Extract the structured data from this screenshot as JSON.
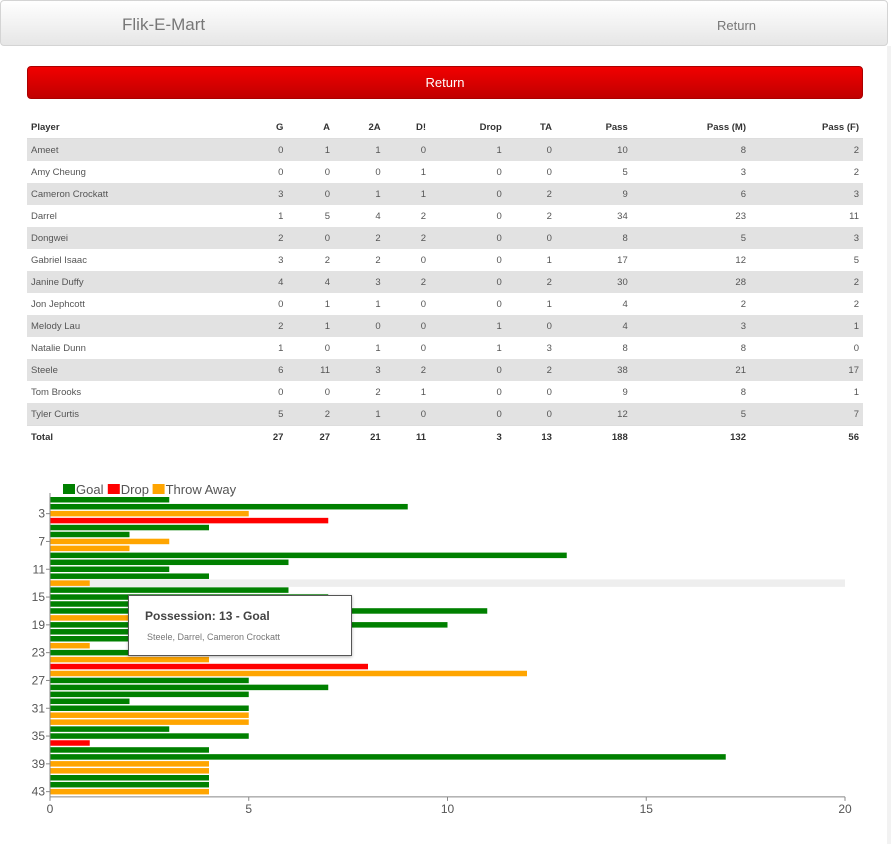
{
  "navbar": {
    "brand": "Flik-E-Mart",
    "return_label": "Return"
  },
  "return_button": {
    "label": "Return"
  },
  "stats_table": {
    "columns": [
      "Player",
      "G",
      "A",
      "2A",
      "D!",
      "Drop",
      "TA",
      "Pass",
      "Pass (M)",
      "Pass (F)"
    ],
    "rows": [
      [
        "Ameet",
        "0",
        "1",
        "1",
        "0",
        "1",
        "0",
        "10",
        "8",
        "2"
      ],
      [
        "Amy Cheung",
        "0",
        "0",
        "0",
        "1",
        "0",
        "0",
        "5",
        "3",
        "2"
      ],
      [
        "Cameron Crockatt",
        "3",
        "0",
        "1",
        "1",
        "0",
        "2",
        "9",
        "6",
        "3"
      ],
      [
        "Darrel",
        "1",
        "5",
        "4",
        "2",
        "0",
        "2",
        "34",
        "23",
        "11"
      ],
      [
        "Dongwei",
        "2",
        "0",
        "2",
        "2",
        "0",
        "0",
        "8",
        "5",
        "3"
      ],
      [
        "Gabriel Isaac",
        "3",
        "2",
        "2",
        "0",
        "0",
        "1",
        "17",
        "12",
        "5"
      ],
      [
        "Janine Duffy",
        "4",
        "4",
        "3",
        "2",
        "0",
        "2",
        "30",
        "28",
        "2"
      ],
      [
        "Jon Jephcott",
        "0",
        "1",
        "1",
        "0",
        "0",
        "1",
        "4",
        "2",
        "2"
      ],
      [
        "Melody Lau",
        "2",
        "1",
        "0",
        "0",
        "1",
        "0",
        "4",
        "3",
        "1"
      ],
      [
        "Natalie Dunn",
        "1",
        "0",
        "1",
        "0",
        "1",
        "3",
        "8",
        "8",
        "0"
      ],
      [
        "Steele",
        "6",
        "11",
        "3",
        "2",
        "0",
        "2",
        "38",
        "21",
        "17"
      ],
      [
        "Tom Brooks",
        "0",
        "0",
        "2",
        "1",
        "0",
        "0",
        "9",
        "8",
        "1"
      ],
      [
        "Tyler Curtis",
        "5",
        "2",
        "1",
        "0",
        "0",
        "0",
        "12",
        "5",
        "7"
      ]
    ],
    "total": [
      "Total",
      "27",
      "27",
      "21",
      "11",
      "3",
      "13",
      "188",
      "132",
      "56"
    ]
  },
  "chart_data": {
    "type": "bar",
    "orientation": "horizontal",
    "legend": [
      {
        "name": "Goal",
        "color": "#008000"
      },
      {
        "name": "Drop",
        "color": "#ff0000"
      },
      {
        "name": "Throw Away",
        "color": "#ffa500"
      }
    ],
    "legend_position": "top-left",
    "xlim": [
      0,
      20
    ],
    "x_ticks": [
      "0",
      "5",
      "10",
      "15",
      "20"
    ],
    "y_ticks": [
      "3",
      "7",
      "11",
      "15",
      "19",
      "23",
      "27",
      "31",
      "35",
      "39",
      "43"
    ],
    "categories": [
      1,
      2,
      3,
      4,
      5,
      6,
      7,
      8,
      9,
      10,
      11,
      12,
      13,
      14,
      15,
      16,
      17,
      18,
      19,
      20,
      21,
      22,
      23,
      24,
      25,
      26,
      27,
      28,
      29,
      30,
      31,
      32,
      33,
      34,
      35,
      36,
      37,
      38,
      39,
      40,
      41,
      42,
      43
    ],
    "values": [
      3,
      9,
      5,
      7,
      4,
      2,
      3,
      2,
      13,
      6,
      3,
      4,
      1,
      6,
      7,
      7,
      11,
      7,
      10,
      5,
      4,
      1,
      2,
      4,
      8,
      12,
      5,
      7,
      5,
      2,
      5,
      5,
      5,
      3,
      5,
      1,
      4,
      17,
      4,
      4,
      4,
      4,
      4
    ],
    "outcomes": [
      "Goal",
      "Goal",
      "Throw Away",
      "Drop",
      "Goal",
      "Goal",
      "Throw Away",
      "Throw Away",
      "Goal",
      "Goal",
      "Goal",
      "Goal",
      "Throw Away",
      "Goal",
      "Goal",
      "Goal",
      "Goal",
      "Throw Away",
      "Goal",
      "Goal",
      "Goal",
      "Throw Away",
      "Goal",
      "Throw Away",
      "Drop",
      "Throw Away",
      "Goal",
      "Goal",
      "Goal",
      "Goal",
      "Goal",
      "Throw Away",
      "Throw Away",
      "Goal",
      "Goal",
      "Drop",
      "Goal",
      "Goal",
      "Throw Away",
      "Throw Away",
      "Goal",
      "Goal",
      "Throw Away"
    ],
    "highlighted": 13,
    "colors": {
      "Goal": "#008000",
      "Drop": "#ff0000",
      "Throw Away": "#ffa500",
      "highlight": "#eeeeee"
    }
  },
  "tooltip": {
    "title": "Possession: 13 - Goal",
    "players": "Steele, Darrel, Cameron Crockatt"
  }
}
